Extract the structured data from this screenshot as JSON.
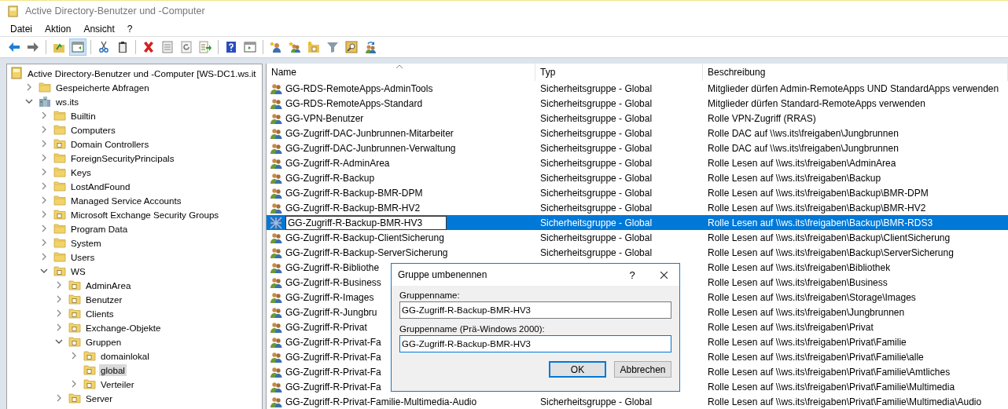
{
  "window": {
    "title": "Active Directory-Benutzer und -Computer"
  },
  "menu": [
    "Datei",
    "Aktion",
    "Ansicht",
    "?"
  ],
  "toolbar": [
    [
      {
        "kind": "back",
        "selected": false
      },
      {
        "kind": "forward",
        "selected": false
      }
    ],
    [
      {
        "kind": "up",
        "selected": false
      },
      {
        "kind": "tree",
        "selected": true
      }
    ],
    [
      {
        "kind": "cut",
        "selected": false
      },
      {
        "kind": "paste",
        "selected": false
      }
    ],
    [
      {
        "kind": "delete",
        "selected": false
      },
      {
        "kind": "properties",
        "selected": false
      },
      {
        "kind": "refresh",
        "selected": false
      },
      {
        "kind": "export",
        "selected": false
      }
    ],
    [
      {
        "kind": "help",
        "selected": false
      },
      {
        "kind": "actionpane",
        "selected": false
      }
    ],
    [
      {
        "kind": "newuser",
        "selected": false
      },
      {
        "kind": "newgroup",
        "selected": false
      },
      {
        "kind": "newou",
        "selected": false
      },
      {
        "kind": "filter",
        "selected": false
      },
      {
        "kind": "find",
        "selected": false
      },
      {
        "kind": "addgroup",
        "selected": false
      }
    ]
  ],
  "tree": [
    {
      "label": "Active Directory-Benutzer und -Computer [WS-DC1.ws.it",
      "kind": "snapin",
      "expandable": false,
      "selected": false,
      "children": [
        {
          "label": "Gespeicherte Abfragen",
          "kind": "folder",
          "expandable": true,
          "expanded": false,
          "selected": false
        },
        {
          "label": "ws.its",
          "kind": "domain",
          "expandable": true,
          "expanded": true,
          "selected": false,
          "children": [
            {
              "label": "Builtin",
              "kind": "folder",
              "expandable": true,
              "expanded": false,
              "selected": false
            },
            {
              "label": "Computers",
              "kind": "folder",
              "expandable": true,
              "expanded": false,
              "selected": false
            },
            {
              "label": "Domain Controllers",
              "kind": "ou",
              "expandable": true,
              "expanded": false,
              "selected": false
            },
            {
              "label": "ForeignSecurityPrincipals",
              "kind": "folder",
              "expandable": true,
              "expanded": false,
              "selected": false
            },
            {
              "label": "Keys",
              "kind": "folder",
              "expandable": true,
              "expanded": false,
              "selected": false
            },
            {
              "label": "LostAndFound",
              "kind": "folder",
              "expandable": true,
              "expanded": false,
              "selected": false
            },
            {
              "label": "Managed Service Accounts",
              "kind": "folder",
              "expandable": true,
              "expanded": false,
              "selected": false
            },
            {
              "label": "Microsoft Exchange Security Groups",
              "kind": "ou",
              "expandable": true,
              "expanded": false,
              "selected": false
            },
            {
              "label": "Program Data",
              "kind": "folder",
              "expandable": true,
              "expanded": false,
              "selected": false
            },
            {
              "label": "System",
              "kind": "folder",
              "expandable": true,
              "expanded": false,
              "selected": false
            },
            {
              "label": "Users",
              "kind": "folder",
              "expandable": true,
              "expanded": false,
              "selected": false
            },
            {
              "label": "WS",
              "kind": "ou",
              "expandable": true,
              "expanded": true,
              "selected": false,
              "children": [
                {
                  "label": "AdminArea",
                  "kind": "ou",
                  "expandable": true,
                  "expanded": false,
                  "selected": false
                },
                {
                  "label": "Benutzer",
                  "kind": "ou",
                  "expandable": true,
                  "expanded": false,
                  "selected": false
                },
                {
                  "label": "Clients",
                  "kind": "ou",
                  "expandable": true,
                  "expanded": false,
                  "selected": false
                },
                {
                  "label": "Exchange-Objekte",
                  "kind": "ou",
                  "expandable": true,
                  "expanded": false,
                  "selected": false
                },
                {
                  "label": "Gruppen",
                  "kind": "ou",
                  "expandable": true,
                  "expanded": true,
                  "selected": false,
                  "children": [
                    {
                      "label": "domainlokal",
                      "kind": "ou",
                      "expandable": true,
                      "expanded": false,
                      "selected": false
                    },
                    {
                      "label": "global",
                      "kind": "ou",
                      "expandable": false,
                      "selected": true
                    },
                    {
                      "label": "Verteiler",
                      "kind": "ou",
                      "expandable": true,
                      "expanded": false,
                      "selected": false
                    }
                  ]
                },
                {
                  "label": "Server",
                  "kind": "ou",
                  "expandable": true,
                  "expanded": false,
                  "selected": false
                }
              ]
            }
          ]
        }
      ]
    }
  ],
  "table": {
    "columns": [
      "Name",
      "Typ",
      "Beschreibung"
    ],
    "rows": [
      {
        "name": "GG-RDS-RemoteApps-AdminTools",
        "type": "Sicherheitsgruppe - Global",
        "description": "Mitglieder dürfen Admin-RemoteApps UND StandardApps verwenden",
        "selected": false
      },
      {
        "name": "GG-RDS-RemoteApps-Standard",
        "type": "Sicherheitsgruppe - Global",
        "description": "Mitglieder dürfen Standard-RemoteApps verwenden",
        "selected": false
      },
      {
        "name": "GG-VPN-Benutzer",
        "type": "Sicherheitsgruppe - Global",
        "description": "Rolle VPN-Zugriff (RRAS)",
        "selected": false
      },
      {
        "name": "GG-Zugriff-DAC-Junbrunnen-Mitarbeiter",
        "type": "Sicherheitsgruppe - Global",
        "description": "Rolle DAC auf \\\\ws.its\\freigaben\\Jungbrunnen",
        "selected": false
      },
      {
        "name": "GG-Zugriff-DAC-Junbrunnen-Verwaltung",
        "type": "Sicherheitsgruppe - Global",
        "description": "Rolle DAC auf \\\\ws.its\\freigaben\\Jungbrunnen",
        "selected": false
      },
      {
        "name": "GG-Zugriff-R-AdminArea",
        "type": "Sicherheitsgruppe - Global",
        "description": "Rolle Lesen auf \\\\ws.its\\freigaben\\AdminArea",
        "selected": false
      },
      {
        "name": "GG-Zugriff-R-Backup",
        "type": "Sicherheitsgruppe - Global",
        "description": "Rolle Lesen auf \\\\ws.its\\freigaben\\Backup",
        "selected": false
      },
      {
        "name": "GG-Zugriff-R-Backup-BMR-DPM",
        "type": "Sicherheitsgruppe - Global",
        "description": "Rolle Lesen auf \\\\ws.its\\freigaben\\Backup\\BMR-DPM",
        "selected": false
      },
      {
        "name": "GG-Zugriff-R-Backup-BMR-HV2",
        "type": "Sicherheitsgruppe - Global",
        "description": "Rolle Lesen auf \\\\ws.its\\freigaben\\Backup\\BMR-HV2",
        "selected": false
      },
      {
        "name": "GG-Zugriff-R-Backup-BMR-HV3",
        "type": "Sicherheitsgruppe - Global",
        "description": "Rolle Lesen auf \\\\ws.its\\freigaben\\Backup\\BMR-RDS3",
        "selected": true
      },
      {
        "name": "GG-Zugriff-R-Backup-ClientSicherung",
        "type": "Sicherheitsgruppe - Global",
        "description": "Rolle Lesen auf \\\\ws.its\\freigaben\\Backup\\ClientSicherung",
        "selected": false
      },
      {
        "name": "GG-Zugriff-R-Backup-ServerSicherung",
        "type": "Sicherheitsgruppe - Global",
        "description": "Rolle Lesen auf \\\\ws.its\\freigaben\\Backup\\ServerSicherung",
        "selected": false
      },
      {
        "name": "GG-Zugriff-R-Bibliothe",
        "description": "Rolle Lesen auf \\\\ws.its\\freigaben\\Bibliothek",
        "selected": false
      },
      {
        "name": "GG-Zugriff-R-Business",
        "description": "Rolle Lesen auf \\\\ws.its\\freigaben\\Business",
        "selected": false
      },
      {
        "name": "GG-Zugriff-R-Images",
        "description": "Rolle Lesen auf \\\\ws.its\\freigaben\\Storage\\Images",
        "selected": false
      },
      {
        "name": "GG-Zugriff-R-Jungbru",
        "description": "Rolle Lesen auf \\\\ws.its\\freigaben\\Jungbrunnen",
        "selected": false
      },
      {
        "name": "GG-Zugriff-R-Privat",
        "description": "Rolle Lesen auf \\\\ws.its\\freigaben\\Privat",
        "selected": false
      },
      {
        "name": "GG-Zugriff-R-Privat-Fa",
        "description": "Rolle Lesen auf \\\\ws.its\\freigaben\\Privat\\Familie",
        "selected": false
      },
      {
        "name": "GG-Zugriff-R-Privat-Fa",
        "description": "Rolle Lesen auf \\\\ws.its\\freigaben\\Privat\\Familie\\alle",
        "selected": false
      },
      {
        "name": "GG-Zugriff-R-Privat-Fa",
        "description": "Rolle Lesen auf \\\\ws.its\\freigaben\\Privat\\Familie\\Amtliches",
        "selected": false
      },
      {
        "name": "GG-Zugriff-R-Privat-Fa",
        "description": "Rolle Lesen auf \\\\ws.its\\freigaben\\Privat\\Familie\\Multimedia",
        "selected": false
      },
      {
        "name": "GG-Zugriff-R-Privat-Familie-Multimedia-Audio",
        "type": "Sicherheitsgruppe - Global",
        "description": "Rolle Lesen auf \\\\ws.its\\freigaben\\Privat\\Familie\\Multimedia\\Audio",
        "selected": false
      }
    ]
  },
  "dialog": {
    "title": "Gruppe umbenennen",
    "help": "?",
    "fields": [
      {
        "label": "Gruppenname:",
        "value": "GG-Zugriff-R-Backup-BMR-HV3",
        "focused": false
      },
      {
        "label": "Gruppenname (Prä-Windows 2000):",
        "value": "GG-Zugriff-R-Backup-BMR-HV3",
        "focused": true
      }
    ],
    "buttons": [
      {
        "label": "OK",
        "default": true
      },
      {
        "label": "Abbrechen",
        "default": false
      }
    ]
  }
}
